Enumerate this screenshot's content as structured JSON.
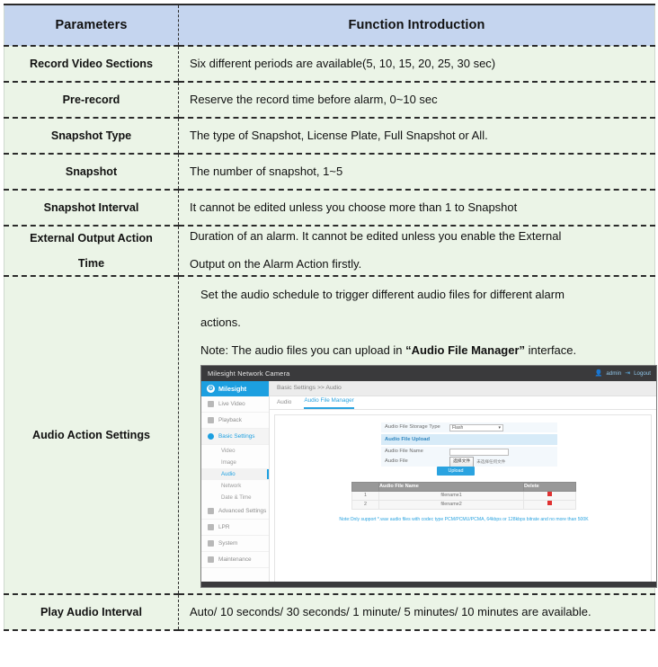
{
  "table": {
    "headers": {
      "parameter": "Parameters",
      "description": "Function Introduction"
    },
    "rows": [
      {
        "parameter": "Record Video Sections",
        "description": "Six different periods are available(5, 10, 15, 20, 25, 30 sec)"
      },
      {
        "parameter": "Pre-record",
        "description": "Reserve the record time before alarm, 0~10 sec"
      },
      {
        "parameter": "Snapshot Type",
        "description": "The type of Snapshot, License Plate, Full Snapshot or All."
      },
      {
        "parameter": "Snapshot",
        "description": "The number of snapshot, 1~5"
      },
      {
        "parameter": "Snapshot Interval",
        "description": "It cannot be edited unless you choose more than 1 to Snapshot"
      },
      {
        "parameter_line1": "External Output Action",
        "parameter_line2": "Time",
        "description_line1": "Duration of an alarm. It cannot be edited unless you enable the External",
        "description_line2": "Output on the Alarm Action firstly."
      },
      {
        "parameter": "Audio Action Settings",
        "description_line1": "Set the audio schedule to trigger different audio files for different alarm",
        "description_line2": "actions.",
        "note_prefix": "Note: The audio files you can upload in ",
        "note_bold": "“Audio File Manager”",
        "note_suffix": " interface."
      },
      {
        "parameter": "Play Audio Interval",
        "description": "Auto/ 10 seconds/ 30 seconds/ 1 minute/ 5 minutes/ 10 minutes are available."
      }
    ]
  },
  "screenshot": {
    "topbar": {
      "title": "Milesight Network Camera",
      "user": "admin",
      "logout": "Logout"
    },
    "sidebar": {
      "logo": "Milesight",
      "items": [
        {
          "label": "Live Video"
        },
        {
          "label": "Playback"
        },
        {
          "label": "Basic Settings"
        }
      ],
      "subitems": [
        {
          "label": "Video"
        },
        {
          "label": "Image"
        },
        {
          "label": "Audio"
        },
        {
          "label": "Network"
        },
        {
          "label": "Date & Time"
        }
      ],
      "items2": [
        {
          "label": "Advanced Settings"
        },
        {
          "label": "LPR"
        },
        {
          "label": "System"
        },
        {
          "label": "Maintenance"
        }
      ]
    },
    "breadcrumb": "Basic Settings >> Audio",
    "tabs": [
      {
        "label": "Audio"
      },
      {
        "label": "Audio File Manager"
      }
    ],
    "form": {
      "storage_type_label": "Audio File Storage Type",
      "storage_type_value": "Flash",
      "section_title": "Audio File Upload",
      "file_name_label": "Audio File Name",
      "file_name_value": "",
      "file_label": "Audio File",
      "file_button": "选择文件",
      "file_status": "未选择任何文件",
      "upload_button": "Upload"
    },
    "file_table": {
      "headers": [
        "",
        "Audio File Name",
        "Delete"
      ],
      "rows": [
        {
          "index": "1",
          "name": "filename1",
          "delete": "×"
        },
        {
          "index": "2",
          "name": "filename2",
          "delete": "×"
        }
      ]
    },
    "file_note": "Note:Only support *.wav audio files with codec type PCM/PCMU/PCMA, 64kbps or 128kbps bitrate and no more than 500K"
  },
  "colors": {
    "header_bg": "#c5d5ef",
    "body_bg": "#ebf4e7",
    "accent_blue": "#2aa3e0",
    "border_dark": "#2b2b2b"
  }
}
